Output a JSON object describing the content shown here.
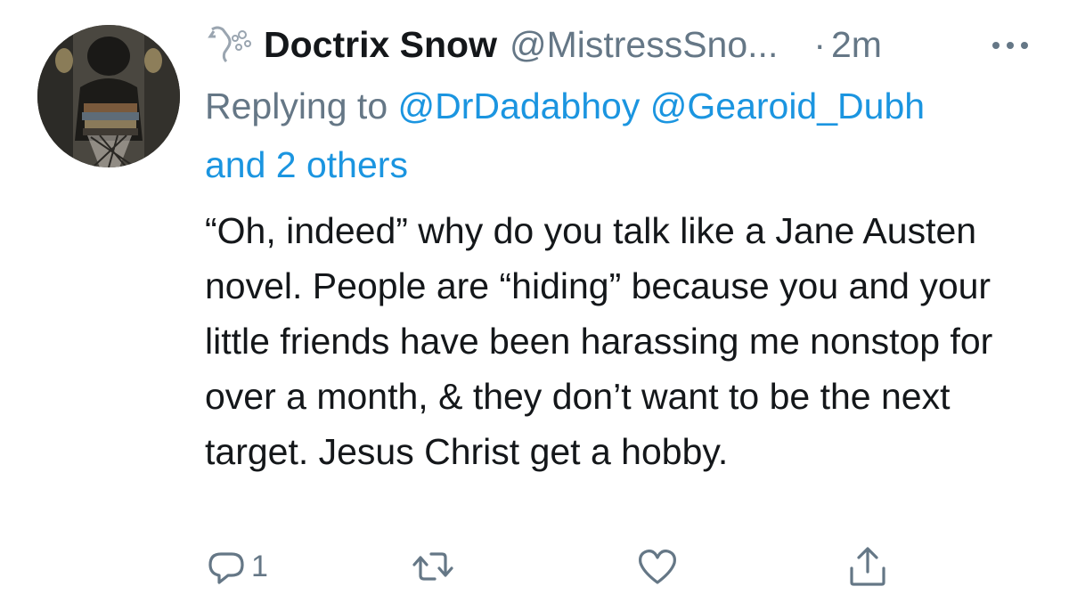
{
  "tweet": {
    "display_name": "Doctrix Snow",
    "handle": "@MistressSno...",
    "separator": "·",
    "time": "2m",
    "replying_prefix": "Replying to",
    "mentions": [
      "@DrDadabhoy",
      "@Gearoid_Dubh"
    ],
    "others": "and 2 others",
    "text": "“Oh, indeed” why do you talk like a Jane Austen novel. People are “hiding” because you and your little friends have been harassing me nonstop for over a month, & they don’t want to be the next target. Jesus Christ get a hobby.",
    "reply_count": "1"
  },
  "icons": {
    "name_badge": "seahorse-icon",
    "more": "more-dots-icon",
    "reply": "reply-bubble-icon",
    "retweet": "retweet-icon",
    "like": "heart-icon",
    "share": "share-icon"
  },
  "colors": {
    "text": "#14171a",
    "secondary": "#657786",
    "link": "#1b95e0"
  }
}
